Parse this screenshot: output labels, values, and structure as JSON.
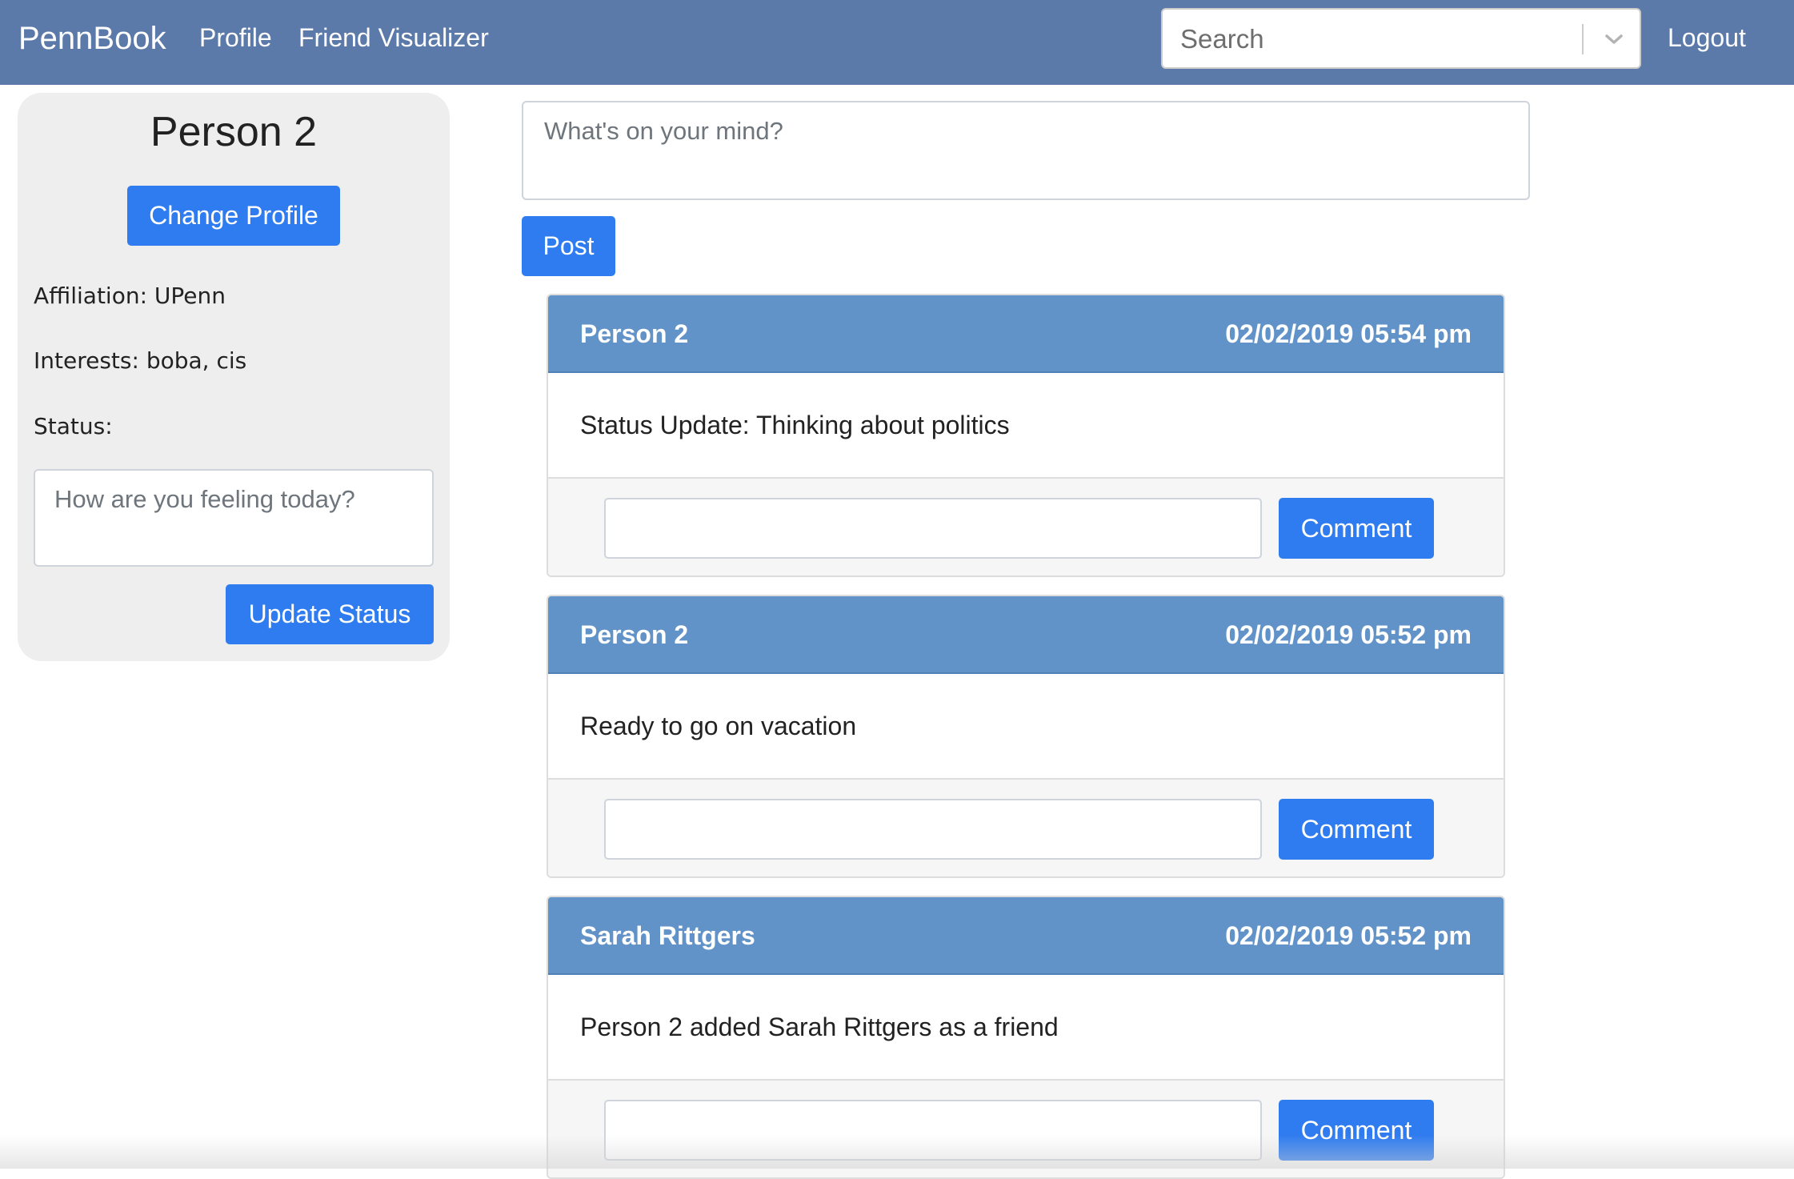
{
  "colors": {
    "navbar": "#5b7aa9",
    "primary_button": "#2f7cf0",
    "card_header": "#6192c8",
    "sidebar_bg": "#eeeeee"
  },
  "navbar": {
    "brand": "PennBook",
    "links": [
      "Profile",
      "Friend Visualizer"
    ],
    "search_placeholder": "Search",
    "search_icon": "chevron-down-icon",
    "logout": "Logout"
  },
  "sidebar": {
    "name": "Person 2",
    "change_profile_label": "Change Profile",
    "affiliation": "Affiliation: UPenn",
    "interests": "Interests: boba, cis",
    "status_label": "Status:",
    "status_placeholder": "How are you feeling today?",
    "update_status_label": "Update Status"
  },
  "composer": {
    "placeholder": "What's on your mind?",
    "post_label": "Post"
  },
  "posts": [
    {
      "author": "Person 2",
      "date": "02/02/2019 05:54 pm",
      "content": "Status Update: Thinking about politics",
      "comment_label": "Comment"
    },
    {
      "author": "Person 2",
      "date": "02/02/2019 05:52 pm",
      "content": "Ready to go on vacation",
      "comment_label": "Comment"
    },
    {
      "author": "Sarah Rittgers",
      "date": "02/02/2019 05:52 pm",
      "content": "Person 2 added Sarah Rittgers as a friend",
      "comment_label": "Comment"
    }
  ]
}
